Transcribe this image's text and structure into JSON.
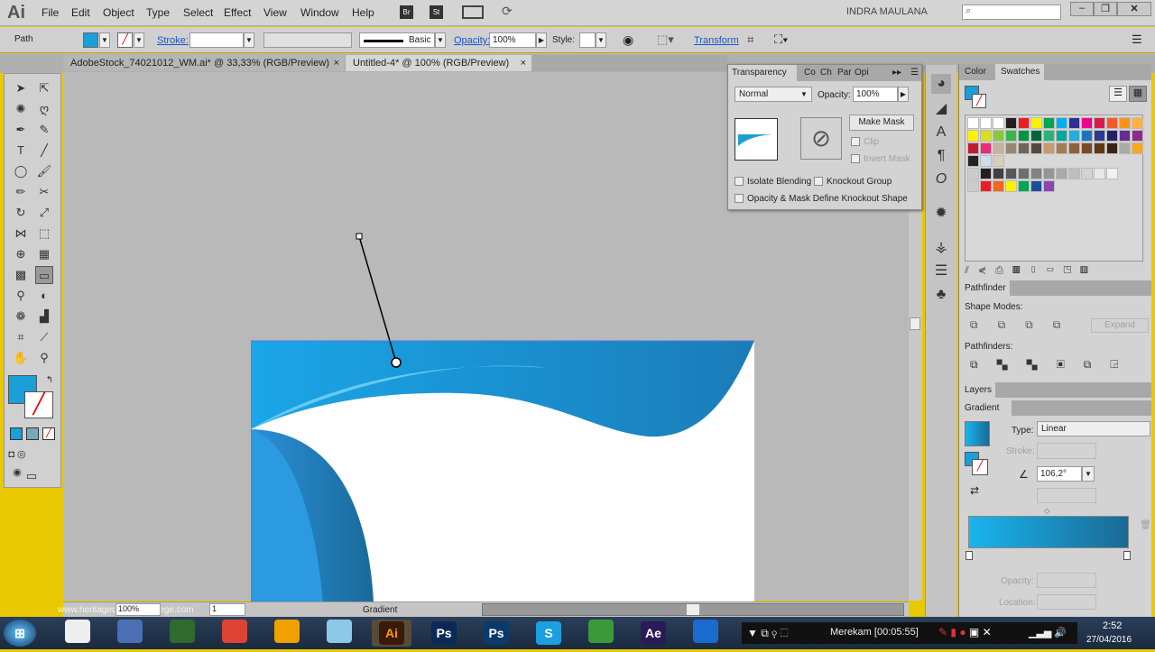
{
  "app": {
    "logo": "Ai",
    "user": "INDRA MAULANA",
    "search_placeholder": ""
  },
  "menu": [
    "File",
    "Edit",
    "Object",
    "Type",
    "Select",
    "Effect",
    "View",
    "Window",
    "Help"
  ],
  "menu_icons": [
    "bridge-icon",
    "stock-icon",
    "workspace-icon",
    "sync-icon"
  ],
  "menu_icon_labels": [
    "Br",
    "St"
  ],
  "control": {
    "selection": "Path",
    "stroke_label": "Stroke:",
    "brush": "Basic",
    "opacity_label": "Opacity:",
    "opacity": "100%",
    "style_label": "Style:",
    "transform": "Transform"
  },
  "tabs": [
    {
      "label": "AdobeStock_74021012_WM.ai* @ 33,33% (RGB/Preview)",
      "active": false
    },
    {
      "label": "Untitled-4* @ 100% (RGB/Preview)",
      "active": true
    }
  ],
  "transparency": {
    "tabs": [
      "Transparency",
      "Co",
      "Ch",
      "Par",
      "Opi"
    ],
    "blend_mode": "Normal",
    "opacity_label": "Opacity:",
    "opacity": "100%",
    "make_mask": "Make Mask",
    "clip": "Clip",
    "invert_mask": "Invert Mask",
    "isolate_blending": "Isolate Blending",
    "knockout_group": "Knockout Group",
    "opacity_mask": "Opacity & Mask Define Knockout Shape"
  },
  "swatches": {
    "tabs": [
      "Color",
      "Swatches"
    ],
    "rows": [
      [
        "#ffffff",
        "#ffffff",
        "#ffffff",
        "#231f20",
        "#ed1c24",
        "#fff200",
        "#00a651",
        "#00aeef",
        "#2e3192",
        "#ec008c",
        "#d71c4b",
        "#f15a29",
        "#f7941d",
        "#fbb040"
      ],
      [
        "#fff200",
        "#d7df23",
        "#8dc63f",
        "#39b54a",
        "#009444",
        "#006838",
        "#26b47c",
        "#00a99d",
        "#27aae1",
        "#1c75bc",
        "#2b3990",
        "#262262",
        "#662d91",
        "#92278f"
      ],
      [
        "#be1e2d",
        "#ee2a7b",
        "#c2b59b",
        "#998675",
        "#736357",
        "#534741",
        "#c69c6d",
        "#a67c52",
        "#8c6239",
        "#754c24",
        "#603913",
        "#3c2415",
        "#aaaaaa",
        "#f7a81b"
      ]
    ],
    "grays": [
      "#231f20",
      "#414042",
      "#58595b",
      "#6d6e71",
      "#808285",
      "#939598",
      "#a7a9ac",
      "#bcbec0",
      "#d1d3d4",
      "#e6e7e8",
      "#f1f2f2"
    ],
    "brights": [
      "#ed1c24",
      "#f26522",
      "#fff200",
      "#00a651",
      "#1c4e9d",
      "#8e44ad"
    ]
  },
  "pathfinder": {
    "title": "Pathfinder",
    "shape_modes": "Shape Modes:",
    "pathfinders": "Pathfinders:",
    "expand": "Expand"
  },
  "layers": {
    "title": "Layers"
  },
  "gradient": {
    "title": "Gradient",
    "type_label": "Type:",
    "type": "Linear",
    "stroke_label": "Stroke:",
    "angle": "106,2°",
    "opacity_label": "Opacity:",
    "location_label": "Location:",
    "start_color": "#1ab4ee",
    "end_color": "#1a6a94"
  },
  "status": {
    "zoom": "100%",
    "page": "1",
    "tool": "Gradient",
    "watermark": "www.heritagechristiancollege.com"
  },
  "taskbar": {
    "apps": [
      "Start",
      "Metro",
      "Remote",
      "Monitor",
      "Chrome",
      "Avast",
      "Files",
      "Ai",
      "Ps",
      "Ps",
      "S",
      "IDM",
      "Ae",
      "IE"
    ],
    "recording": "Merekam [00:05:55]",
    "time": "2:52",
    "date": "27/04/2016"
  },
  "colors": {
    "fill": "#1a9fd8",
    "accent": "#1a55c9"
  }
}
